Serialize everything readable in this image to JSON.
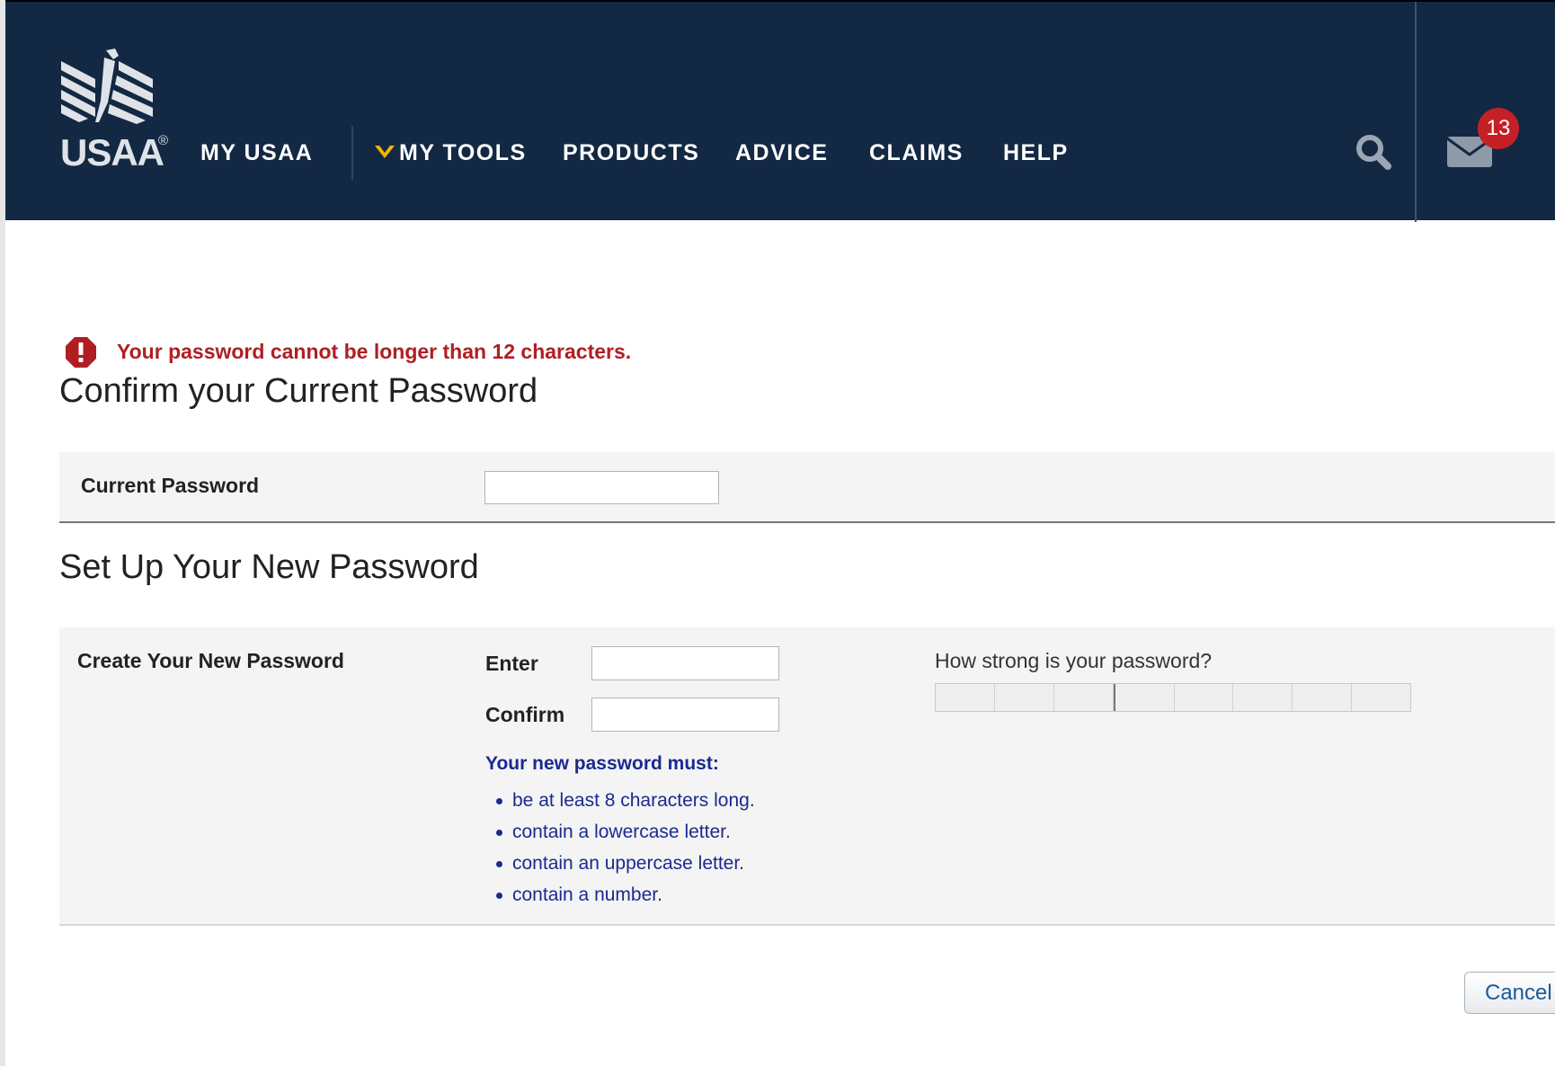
{
  "header": {
    "logo_text": "USAA",
    "logo_mark": "®",
    "nav": [
      {
        "label": "MY USAA"
      },
      {
        "label": "MY TOOLS"
      },
      {
        "label": "PRODUCTS"
      },
      {
        "label": "ADVICE"
      },
      {
        "label": "CLAIMS"
      },
      {
        "label": "HELP"
      }
    ],
    "messages_count": "13",
    "colors": {
      "background": "#132843",
      "chevron": "#f2b600",
      "badge": "#c62027"
    }
  },
  "error": {
    "icon": "error-octagon-icon",
    "message": "Your password cannot be longer than 12 characters."
  },
  "current_section": {
    "title": "Confirm your Current Password",
    "field_label": "Current Password",
    "field_value": ""
  },
  "new_section": {
    "title": "Set Up Your New Password",
    "row_label": "Create Your New Password",
    "enter_label": "Enter",
    "enter_value": "",
    "confirm_label": "Confirm",
    "confirm_value": "",
    "rules_title": "Your new password must:",
    "rules": [
      "be at least 8 characters long.",
      "contain a lowercase letter.",
      "contain an uppercase letter.",
      "contain a number."
    ],
    "strength_label": "How strong is your password?",
    "strength_level": 0
  },
  "actions": {
    "cancel_label": "Cancel"
  }
}
